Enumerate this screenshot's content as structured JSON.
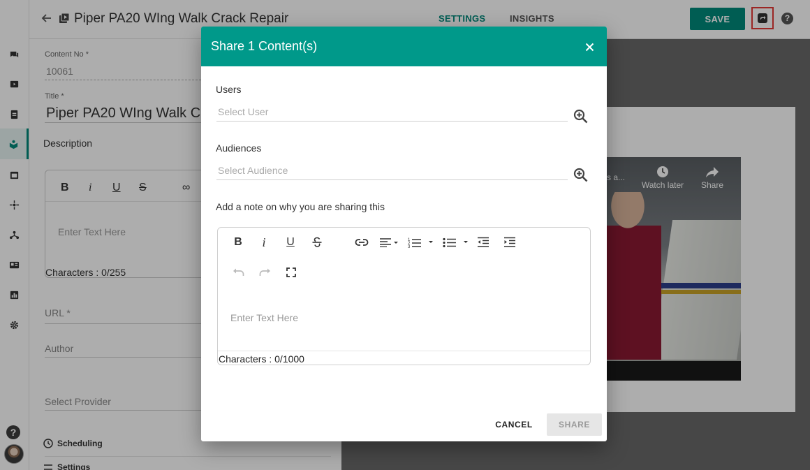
{
  "header": {
    "title": "Piper PA20 WIng Walk Crack Repair",
    "tabs": [
      {
        "label": "SETTINGS",
        "active": true
      },
      {
        "label": "INSIGHTS",
        "active": false
      }
    ],
    "save_label": "SAVE"
  },
  "sidebar": {
    "items": [
      {
        "icon": "chat-icon"
      },
      {
        "icon": "video-icon"
      },
      {
        "icon": "clipboard-icon"
      },
      {
        "icon": "learning-icon",
        "active": true
      },
      {
        "icon": "calendar-icon"
      },
      {
        "icon": "network-icon"
      },
      {
        "icon": "hierarchy-icon"
      },
      {
        "icon": "id-card-icon"
      },
      {
        "icon": "report-icon"
      },
      {
        "icon": "gear-icon"
      }
    ],
    "help_glyph": "?"
  },
  "form": {
    "content_no_label": "Content No *",
    "content_no_value": "10061",
    "title_label": "Title *",
    "title_value": "Piper PA20 WIng Walk C",
    "description_heading": "Description",
    "editor_placeholder": "Enter Text Here",
    "characters": "Characters : 0/255",
    "url_label": "URL *",
    "author_label": "Author",
    "provider_label": "Select Provider",
    "scheduling_label": "Scheduling",
    "settings_label": "Settings"
  },
  "preview": {
    "video_title_fragment": "s a...",
    "watch_later": "Watch later",
    "share": "Share"
  },
  "modal": {
    "title": "Share 1 Content(s)",
    "users_label": "Users",
    "users_placeholder": "Select User",
    "audiences_label": "Audiences",
    "audiences_placeholder": "Select Audience",
    "note_label": "Add a note on why you are sharing this",
    "editor": {
      "bold": "B",
      "italic": "i",
      "underline": "U",
      "placeholder": "Enter Text Here",
      "characters": "Characters : 0/1000"
    },
    "cancel_label": "CANCEL",
    "share_label": "SHARE"
  },
  "colors": {
    "accent": "#00897b",
    "modal_header": "#00998a",
    "highlight_border": "#e53935"
  }
}
